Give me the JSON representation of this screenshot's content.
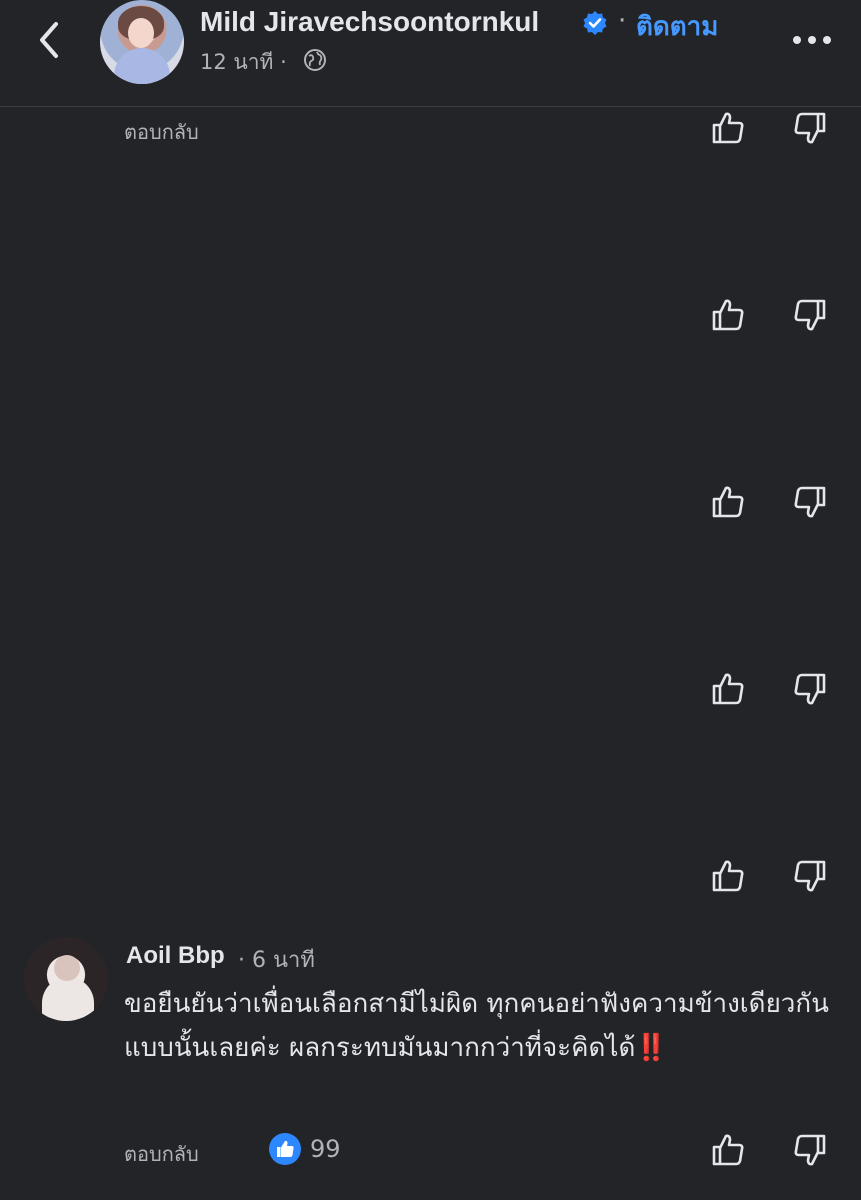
{
  "header": {
    "author_name": "Mild Jiravechsoontornkul",
    "separator": "·",
    "follow_label": "ติดตาม",
    "timestamp": "12 นาที ·",
    "back_icon": "chevron-left-icon",
    "more_icon": "more-horizontal-icon",
    "verified_icon": "verified-badge-icon",
    "globe_icon": "globe-icon"
  },
  "top_reply_label": "ตอบกลับ",
  "comment": {
    "author": "Aoil Bbp",
    "time": "· 6 นาที",
    "text": "ขอยืนยันว่าเพื่อนเลือกสามีไม่ผิด ทุกคนอย่าฟังความข้างเดียวกันแบบนั้นเลยค่ะ ผลกระทบมันมากกว่าที่จะคิดได้",
    "emoji": "‼️",
    "reply_label": "ตอบกลับ",
    "like_count": "99"
  },
  "colors": {
    "background": "#232427",
    "link": "#4599ff",
    "like_badge": "#2d88ff",
    "muted": "#b0b3b8",
    "text": "#e4e6eb"
  }
}
